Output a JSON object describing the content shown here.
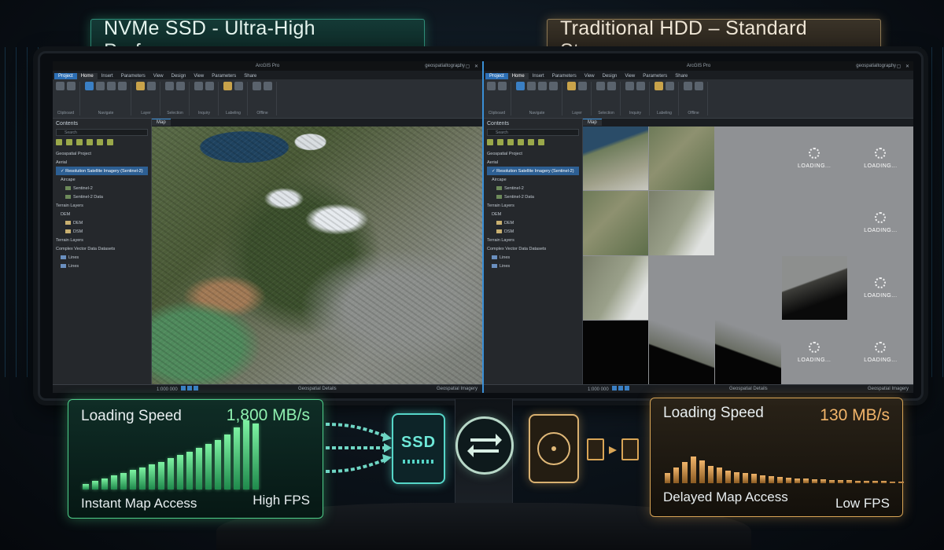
{
  "headlines": {
    "ssd": "NVMe SSD - Ultra-High Performance",
    "hdd": "Traditional HDD – Standard Storage"
  },
  "left_app": {
    "window_title": "ArcGIS Pro",
    "user": "geospatialtography",
    "tabs": [
      "Project",
      "Home",
      "Insert",
      "Parameters",
      "View",
      "Design",
      "View",
      "Parameters",
      "Share"
    ],
    "ribbon_groups": [
      "Clipboard",
      "Navigate",
      "Layer",
      "Selection",
      "Inquiry",
      "Labeling",
      "Offline"
    ],
    "contents_title": "Contents",
    "search_placeholder": "Search",
    "project_label": "Geospatial Project",
    "layers": [
      {
        "label": "Aerial",
        "indent": 0,
        "selected": false,
        "swatch": ""
      },
      {
        "label": "✓ Resolution Satellite Imagery (Sentinel-2)",
        "indent": 1,
        "selected": true,
        "swatch": ""
      },
      {
        "label": "Aircape",
        "indent": 1,
        "selected": false,
        "swatch": ""
      },
      {
        "label": "Sentinel-2",
        "indent": 2,
        "selected": false,
        "swatch": "#6d8a5a"
      },
      {
        "label": "Sentinel-2 Data",
        "indent": 2,
        "selected": false,
        "swatch": "#6d8a5a"
      },
      {
        "label": "Terrain Layers",
        "indent": 0,
        "selected": false,
        "swatch": ""
      },
      {
        "label": "DEM",
        "indent": 1,
        "selected": false,
        "swatch": ""
      },
      {
        "label": "DEM",
        "indent": 2,
        "selected": false,
        "swatch": "#c9b070"
      },
      {
        "label": "DSM",
        "indent": 2,
        "selected": false,
        "swatch": "#c9b070"
      },
      {
        "label": "Terrain Layers",
        "indent": 0,
        "selected": false,
        "swatch": ""
      },
      {
        "label": "Complex Vector Data Datasets",
        "indent": 0,
        "selected": false,
        "swatch": ""
      },
      {
        "label": "Lines",
        "indent": 1,
        "selected": false,
        "swatch": "#6a8fbf"
      },
      {
        "label": "Lines",
        "indent": 1,
        "selected": false,
        "swatch": "#6a8fbf"
      }
    ],
    "map_tab": "Map",
    "status_scale": "1:000 000",
    "status_coords": "Geospatial Details",
    "status_right": "Geospatial Imagery"
  },
  "right_app": {
    "window_title": "ArcGIS Pro",
    "user": "geospatialtography",
    "tabs": [
      "Project",
      "Home",
      "Insert",
      "Parameters",
      "View",
      "Design",
      "View",
      "Parameters",
      "Share"
    ],
    "ribbon_groups": [
      "Clipboard",
      "Navigate",
      "Layer",
      "Selection",
      "Inquiry",
      "Labeling",
      "Offline"
    ],
    "contents_title": "Contents",
    "search_placeholder": "Search",
    "project_label": "Geospatial Project",
    "layers": [
      {
        "label": "Aerial",
        "indent": 0,
        "selected": false,
        "swatch": ""
      },
      {
        "label": "✓ Resolution Satellite Imagery (Sentinel-2)",
        "indent": 1,
        "selected": true,
        "swatch": ""
      },
      {
        "label": "Aircape",
        "indent": 1,
        "selected": false,
        "swatch": ""
      },
      {
        "label": "Sentinel-2",
        "indent": 2,
        "selected": false,
        "swatch": "#6d8a5a"
      },
      {
        "label": "Sentinel-2 Data",
        "indent": 2,
        "selected": false,
        "swatch": "#6d8a5a"
      },
      {
        "label": "Terrain Layers",
        "indent": 0,
        "selected": false,
        "swatch": ""
      },
      {
        "label": "DEM",
        "indent": 1,
        "selected": false,
        "swatch": ""
      },
      {
        "label": "DEM",
        "indent": 2,
        "selected": false,
        "swatch": "#c9b070"
      },
      {
        "label": "DSM",
        "indent": 2,
        "selected": false,
        "swatch": "#c9b070"
      },
      {
        "label": "Terrain Layers",
        "indent": 0,
        "selected": false,
        "swatch": ""
      },
      {
        "label": "Complex Vector Data Datasets",
        "indent": 0,
        "selected": false,
        "swatch": ""
      },
      {
        "label": "Lines",
        "indent": 1,
        "selected": false,
        "swatch": "#6a8fbf"
      },
      {
        "label": "Lines",
        "indent": 1,
        "selected": false,
        "swatch": "#6a8fbf"
      }
    ],
    "map_tab": "Map",
    "loading_text": "LOADING...",
    "status_scale": "1:000 000",
    "status_coords": "Geospatial Details",
    "status_right": "Geospatial Imagery"
  },
  "ssd_panel": {
    "label": "Loading Speed",
    "speed": "1,800 MB/s",
    "footer_left": "Instant Map Access",
    "footer_right": "High FPS",
    "bar_levels": [
      0.08,
      0.12,
      0.16,
      0.2,
      0.24,
      0.28,
      0.32,
      0.36,
      0.4,
      0.45,
      0.5,
      0.55,
      0.6,
      0.66,
      0.72,
      0.8,
      0.9,
      1.0,
      0.95
    ]
  },
  "hdd_panel": {
    "label": "Loading Speed",
    "speed": "130 MB/s",
    "footer_left": "Delayed Map Access",
    "footer_right": "Low FPS",
    "bar_levels": [
      0.35,
      0.55,
      0.75,
      0.95,
      0.8,
      0.6,
      0.55,
      0.45,
      0.4,
      0.35,
      0.32,
      0.28,
      0.25,
      0.22,
      0.2,
      0.18,
      0.16,
      0.14,
      0.13,
      0.12,
      0.11,
      0.1,
      0.09,
      0.08,
      0.07,
      0.07,
      0.06,
      0.06
    ]
  },
  "icons": {
    "ssd_chip_text": "SSD",
    "ssd": "ssd-chip-icon",
    "swap": "swap-arrows-icon",
    "hdd": "hard-drive-icon",
    "docs": "document-transfer-icon"
  },
  "colors": {
    "ssd_accent": "#4fd08a",
    "hdd_accent": "#d9a556",
    "selection": "#2d5f93",
    "active_tab": "#2d6fb5"
  }
}
